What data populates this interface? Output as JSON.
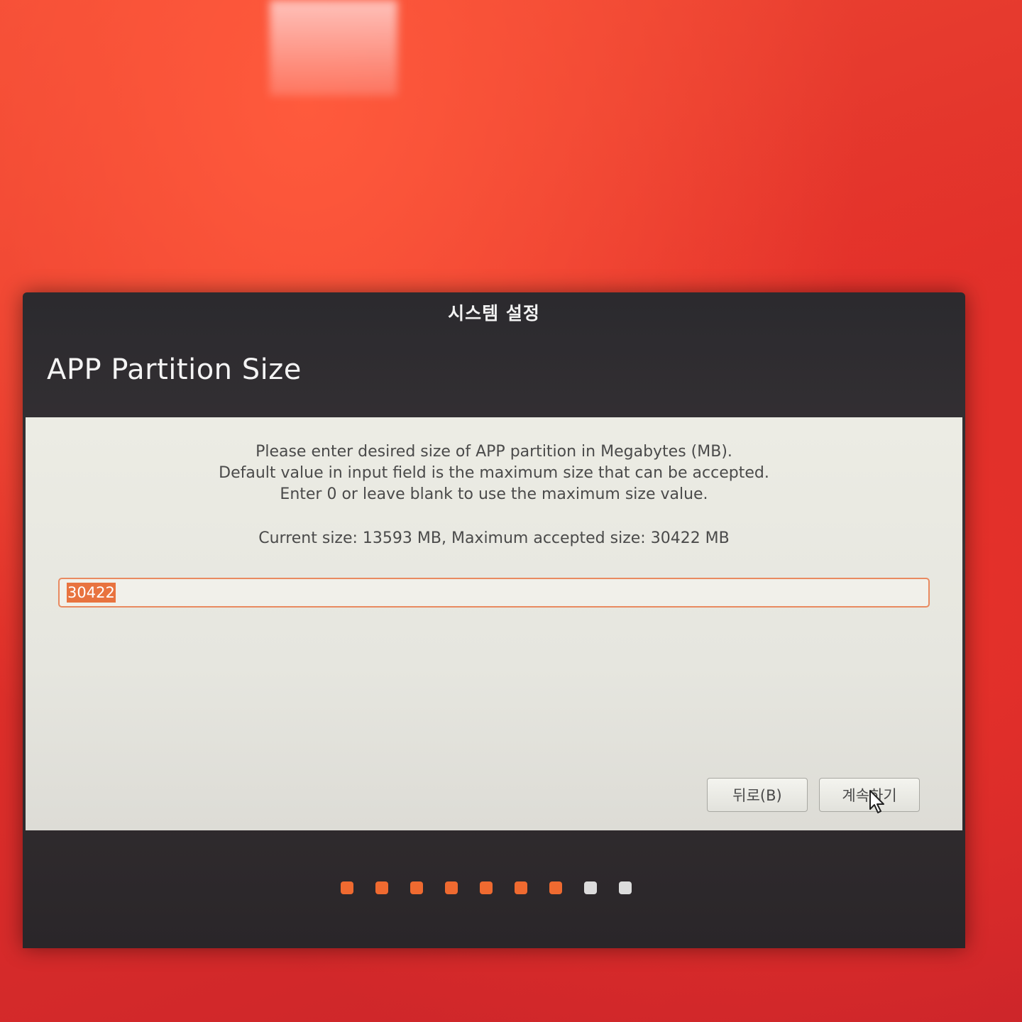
{
  "window": {
    "title": "시스템 설정"
  },
  "page": {
    "heading": "APP Partition Size",
    "message_lines": [
      "Please enter desired size of APP partition in Megabytes (MB).",
      "Default value in input field is the maximum size that can be accepted.",
      "Enter 0 or leave blank to use the maximum size value."
    ],
    "size_info": "Current size: 13593 MB, Maximum accepted size: 30422 MB"
  },
  "input": {
    "value": "30422"
  },
  "buttons": {
    "back_label": "뒤로(B)",
    "continue_label": "계속하기"
  },
  "progress": {
    "total_steps": 9,
    "completed_steps": 7
  },
  "colors": {
    "accent": "#e8733f",
    "background": "#e0302a",
    "dot_active": "#ef6a30",
    "dot_inactive": "#dcdcdc"
  }
}
